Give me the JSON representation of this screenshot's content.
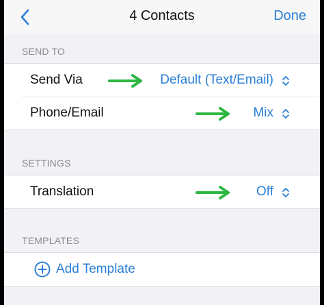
{
  "navbar": {
    "title": "4 Contacts",
    "done_label": "Done",
    "back_icon": "chevron-left-icon"
  },
  "colors": {
    "accent": "#2a7ed6",
    "arrow": "#2db742",
    "background": "#f1f1f6"
  },
  "send_to": {
    "header": "SEND TO",
    "rows": [
      {
        "label": "Send Via",
        "value": "Default (Text/Email)"
      },
      {
        "label": "Phone/Email",
        "value": "Mix"
      }
    ]
  },
  "settings": {
    "header": "SETTINGS",
    "rows": [
      {
        "label": "Translation",
        "value": "Off"
      }
    ]
  },
  "templates": {
    "header": "TEMPLATES",
    "add_label": "Add Template",
    "add_icon": "plus-circle-icon"
  }
}
